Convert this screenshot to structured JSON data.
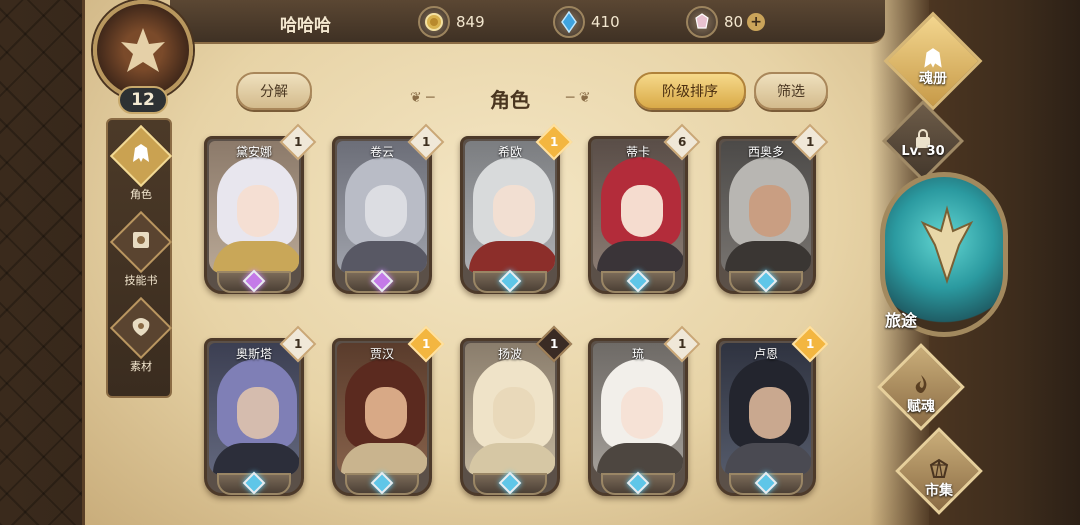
{
  "player": {
    "name": "哈哈哈",
    "level": "12"
  },
  "currencies": [
    {
      "icon": "gold-coin-icon",
      "value": "849"
    },
    {
      "icon": "blue-crystal-icon",
      "value": "410"
    },
    {
      "icon": "pink-gem-icon",
      "value": "80",
      "add": "+"
    }
  ],
  "left_nav": [
    {
      "label": "角色",
      "icon": "helmet-icon",
      "active": true
    },
    {
      "label": "技能书",
      "icon": "skill-book-icon",
      "active": false
    },
    {
      "label": "素材",
      "icon": "material-icon",
      "active": false
    }
  ],
  "header": {
    "title": "角色",
    "decompose_label": "分解",
    "sort_label": "阶级排序",
    "filter_label": "筛选"
  },
  "characters": [
    {
      "name": "黛安娜",
      "rank": "1",
      "rank_color": "white",
      "gem": "purple"
    },
    {
      "name": "卷云",
      "rank": "1",
      "rank_color": "white",
      "gem": "purple"
    },
    {
      "name": "希欧",
      "rank": "1",
      "rank_color": "gold",
      "gem": "blue"
    },
    {
      "name": "蒂卡",
      "rank": "6",
      "rank_color": "white",
      "gem": "blue"
    },
    {
      "name": "西奥多",
      "rank": "1",
      "rank_color": "white",
      "gem": "blue"
    },
    {
      "name": "奥斯塔",
      "rank": "1",
      "rank_color": "white",
      "gem": "blue"
    },
    {
      "name": "贾汉",
      "rank": "1",
      "rank_color": "gold",
      "gem": "blue"
    },
    {
      "name": "扬波",
      "rank": "1",
      "rank_color": "dark",
      "gem": "blue"
    },
    {
      "name": "琉",
      "rank": "1",
      "rank_color": "white",
      "gem": "blue"
    },
    {
      "name": "卢恩",
      "rank": "1",
      "rank_color": "gold",
      "gem": "blue"
    }
  ],
  "right_menu": {
    "soul_book": "魂册",
    "locked_level": "Lv. 30",
    "journey": "旅途",
    "bestow_soul": "赋魂",
    "market": "市集"
  }
}
